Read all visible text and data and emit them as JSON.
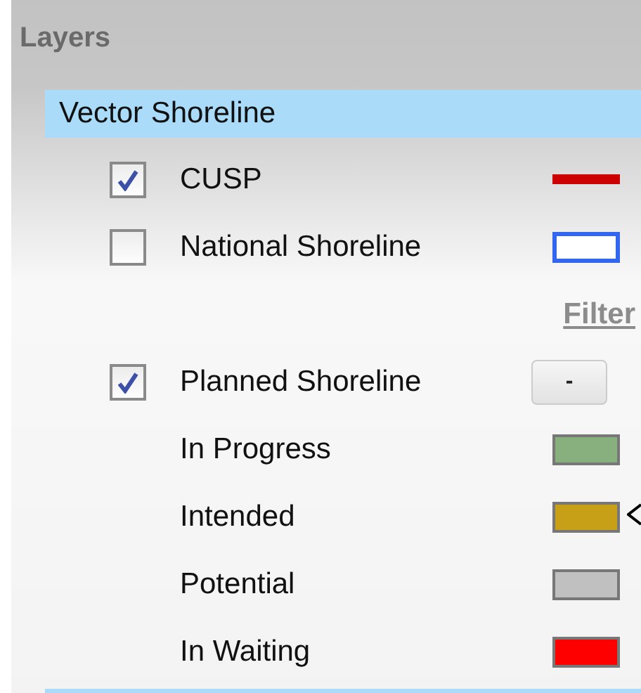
{
  "panel": {
    "title": "Layers"
  },
  "group": {
    "label": "Vector Shoreline",
    "selected": true
  },
  "rows": [
    {
      "kind": "layer",
      "label": "CUSP",
      "checked": true,
      "swatch": {
        "kind": "line",
        "color": "#cc0000"
      }
    },
    {
      "kind": "layer",
      "label": "National Shoreline",
      "checked": false,
      "swatch": {
        "kind": "outline",
        "color": "#3366ee"
      }
    },
    {
      "kind": "link",
      "label": "Filter"
    },
    {
      "kind": "layer",
      "label": "Planned Shoreline",
      "checked": true,
      "button": "-"
    },
    {
      "kind": "legend",
      "label": "In Progress",
      "swatch": {
        "kind": "fill",
        "color": "#88b07e"
      }
    },
    {
      "kind": "legend",
      "label": "Intended",
      "swatch": {
        "kind": "fill",
        "color": "#c8a018"
      },
      "pointer": true
    },
    {
      "kind": "legend",
      "label": "Potential",
      "swatch": {
        "kind": "fill",
        "color": "#c0c0c0"
      }
    },
    {
      "kind": "legend",
      "label": "In Waiting",
      "swatch": {
        "kind": "fill",
        "color": "#ff0000"
      }
    }
  ]
}
